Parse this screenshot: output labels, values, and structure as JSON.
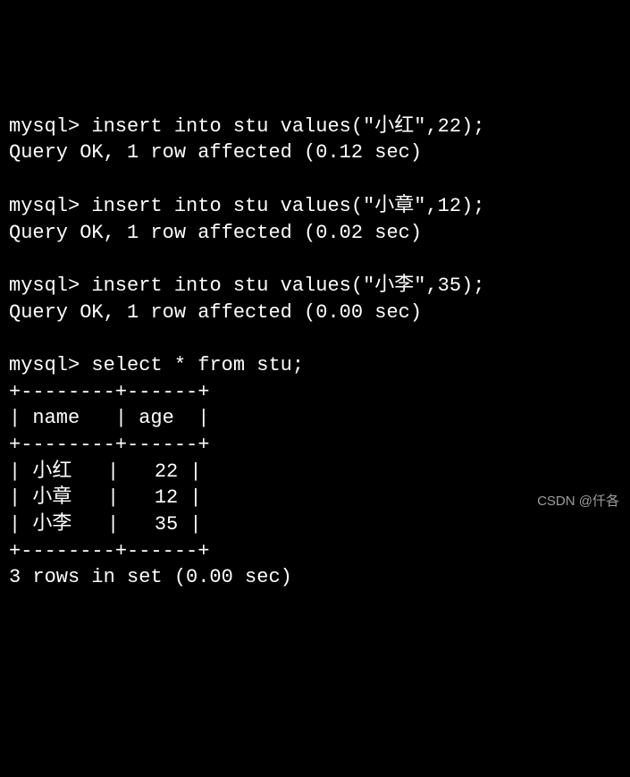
{
  "prompt": "mysql>",
  "blocks": [
    {
      "command": "insert into stu values(\"小红\",22);",
      "response": "Query OK, 1 row affected (0.12 sec)"
    },
    {
      "command": "insert into stu values(\"小章\",12);",
      "response": "Query OK, 1 row affected (0.02 sec)"
    },
    {
      "command": "insert into stu values(\"小李\",35);",
      "response": "Query OK, 1 row affected (0.00 sec)"
    }
  ],
  "select_command": "select * from stu;",
  "table_border": "+--------+------+",
  "table_header": "| name   | age  |",
  "table_rows": [
    "| 小红   |   22 |",
    "| 小章   |   12 |",
    "| 小李   |   35 |"
  ],
  "footer": "3 rows in set (0.00 sec)",
  "watermark": "CSDN @仟各"
}
